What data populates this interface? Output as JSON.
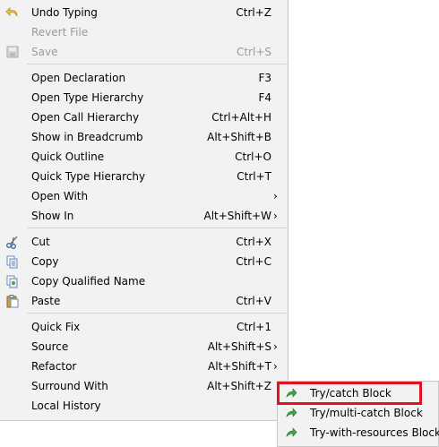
{
  "menu": {
    "undo": {
      "label": "Undo Typing",
      "shortcut": "Ctrl+Z"
    },
    "revert": {
      "label": "Revert File"
    },
    "save": {
      "label": "Save",
      "shortcut": "Ctrl+S"
    },
    "open_declaration": {
      "label": "Open Declaration",
      "shortcut": "F3"
    },
    "open_type_hierarchy": {
      "label": "Open Type Hierarchy",
      "shortcut": "F4"
    },
    "open_call_hierarchy": {
      "label": "Open Call Hierarchy",
      "shortcut": "Ctrl+Alt+H"
    },
    "show_in_breadcrumb": {
      "label": "Show in Breadcrumb",
      "shortcut": "Alt+Shift+B"
    },
    "quick_outline": {
      "label": "Quick Outline",
      "shortcut": "Ctrl+O"
    },
    "quick_type_hierarchy": {
      "label": "Quick Type Hierarchy",
      "shortcut": "Ctrl+T"
    },
    "open_with": {
      "label": "Open With"
    },
    "show_in": {
      "label": "Show In",
      "shortcut": "Alt+Shift+W"
    },
    "cut": {
      "label": "Cut",
      "shortcut": "Ctrl+X"
    },
    "copy": {
      "label": "Copy",
      "shortcut": "Ctrl+C"
    },
    "copy_qualified_name": {
      "label": "Copy Qualified Name"
    },
    "paste": {
      "label": "Paste",
      "shortcut": "Ctrl+V"
    },
    "quick_fix": {
      "label": "Quick Fix",
      "shortcut": "Ctrl+1"
    },
    "source": {
      "label": "Source",
      "shortcut": "Alt+Shift+S"
    },
    "refactor": {
      "label": "Refactor",
      "shortcut": "Alt+Shift+T"
    },
    "surround_with": {
      "label": "Surround With",
      "shortcut": "Alt+Shift+Z"
    },
    "local_history": {
      "label": "Local History"
    },
    "submenu_arrow": "›"
  },
  "submenu": {
    "try_catch": {
      "label": "Try/catch Block"
    },
    "try_multi_catch": {
      "label": "Try/multi-catch Block"
    },
    "try_with_resources": {
      "label": "Try-with-resources Block"
    }
  },
  "colors": {
    "highlight": "#e0141e",
    "menu_bg": "#f2f2f2",
    "template_icon": "#2e9b3a"
  }
}
